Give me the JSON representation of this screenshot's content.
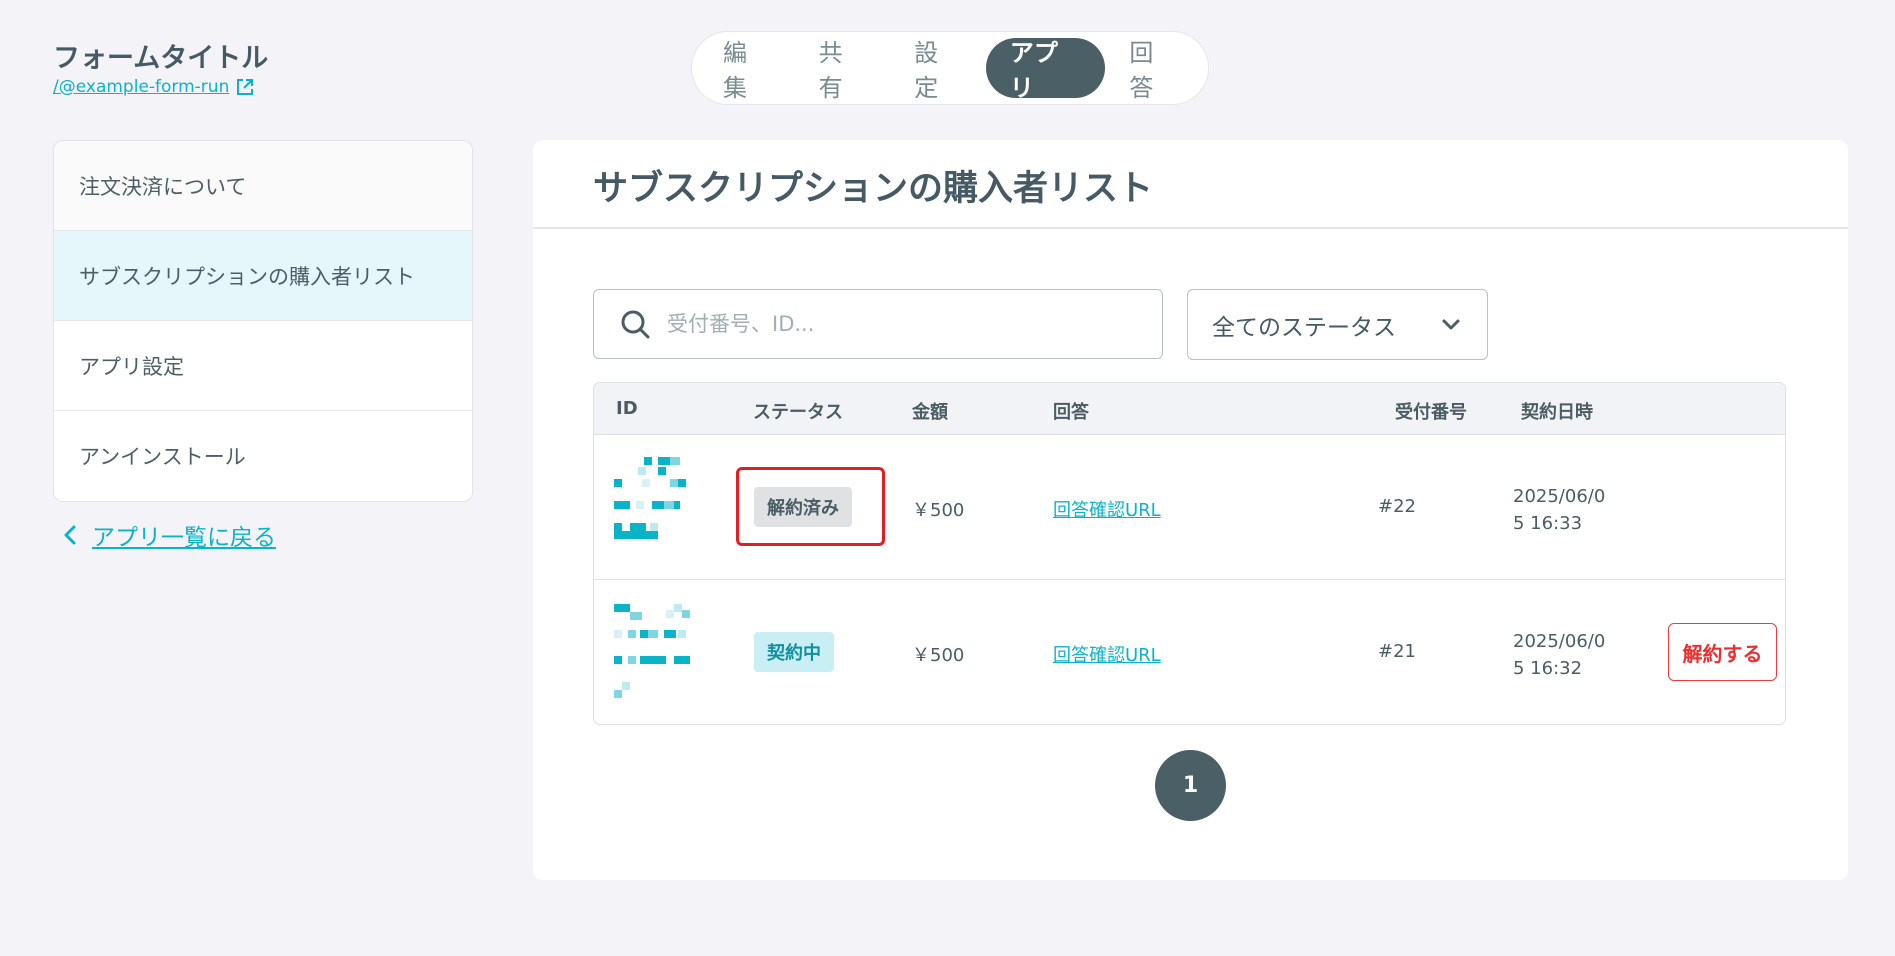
{
  "form": {
    "title": "フォームタイトル",
    "link": "/@example-form-run",
    "link_icon": "external-link-icon"
  },
  "tabs": [
    {
      "label": "編集",
      "active": false
    },
    {
      "label": "共有",
      "active": false
    },
    {
      "label": "設定",
      "active": false
    },
    {
      "label": "アプリ",
      "active": true
    },
    {
      "label": "回答",
      "active": false
    }
  ],
  "sidebar": {
    "items": [
      {
        "label": "注文決済について",
        "active": false
      },
      {
        "label": "サブスクリプションの購入者リスト",
        "active": true
      },
      {
        "label": "アプリ設定",
        "active": false
      },
      {
        "label": "アンインストール",
        "active": false
      }
    ],
    "back_label": "アプリ一覧に戻る"
  },
  "main": {
    "title": "サブスクリプションの購入者リスト",
    "search": {
      "placeholder": "受付番号、ID..."
    },
    "status_filter": {
      "selected": "全てのステータス"
    },
    "table": {
      "columns": [
        "ID",
        "ステータス",
        "金額",
        "回答",
        "受付番号",
        "契約日時"
      ],
      "rows": [
        {
          "status": "解約済み",
          "status_type": "cancelled",
          "amount": "￥500",
          "answer_link": "回答確認URL",
          "number": "#22",
          "date_line1": "2025/06/0",
          "date_line2": "5 16:33",
          "action": ""
        },
        {
          "status": "契約中",
          "status_type": "active",
          "amount": "￥500",
          "answer_link": "回答確認URL",
          "number": "#21",
          "date_line1": "2025/06/0",
          "date_line2": "5 16:32",
          "action": "解約する"
        }
      ]
    },
    "pagination": {
      "current": "1"
    }
  },
  "colors": {
    "accent": "#0bb3c8",
    "dark": "#4b5f67",
    "danger": "#ee2e2e",
    "highlight": "#e02020"
  }
}
